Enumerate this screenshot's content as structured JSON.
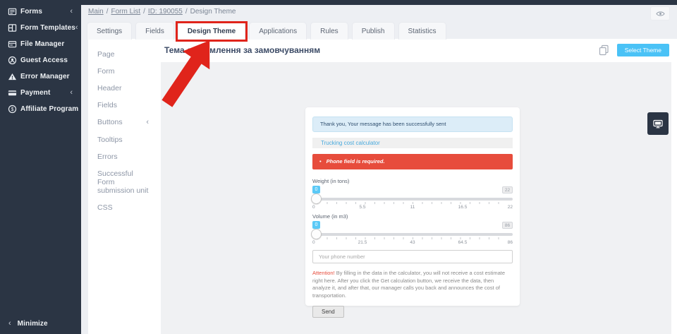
{
  "colors": {
    "sidebar_bg": "#2b3544",
    "accent_blue": "#4ac2f6",
    "link_blue": "#49aadd",
    "error_red": "#e74c3c",
    "annotation_red": "#e0241b",
    "info_alert_bg": "#dcedf8",
    "page_bg": "#edeff3",
    "preview_bg": "#f0f1f3"
  },
  "sidebar": {
    "items": [
      {
        "label": "Forms",
        "icon": "forms-icon",
        "has_submenu": true
      },
      {
        "label": "Form Templates",
        "icon": "form-templates-icon",
        "has_submenu": true
      },
      {
        "label": "File Manager",
        "icon": "file-manager-icon",
        "has_submenu": false
      },
      {
        "label": "Guest Access",
        "icon": "guest-access-icon",
        "has_submenu": false
      },
      {
        "label": "Error Manager",
        "icon": "error-manager-icon",
        "has_submenu": false
      },
      {
        "label": "Payment",
        "icon": "payment-icon",
        "has_submenu": true
      },
      {
        "label": "Affiliate Program",
        "icon": "affiliate-program-icon",
        "has_submenu": false
      }
    ],
    "chevron": "‹",
    "minimize_label": "Minimize"
  },
  "breadcrumb": {
    "separator": "/",
    "links": [
      "Main",
      "Form List",
      "ID: 190055"
    ],
    "current": "Design Theme"
  },
  "tabs": [
    {
      "label": "Settings"
    },
    {
      "label": "Fields"
    },
    {
      "label": "Design Theme",
      "active": true,
      "annotated": true
    },
    {
      "label": "Applications"
    },
    {
      "label": "Rules"
    },
    {
      "label": "Publish"
    },
    {
      "label": "Statistics"
    }
  ],
  "design_menu": {
    "items": [
      {
        "label": "Page"
      },
      {
        "label": "Form"
      },
      {
        "label": "Header"
      },
      {
        "label": "Fields"
      },
      {
        "label": "Buttons",
        "has_submenu": true
      },
      {
        "label": "Tooltips"
      },
      {
        "label": "Errors"
      },
      {
        "label": "Successful Form submission unit"
      },
      {
        "label": "CSS"
      }
    ],
    "chevron": "‹"
  },
  "theme_header": {
    "title": "Тема оформлення за замовчуванням",
    "select_theme_button": "Select Theme"
  },
  "preview_form": {
    "success_alert": "Thank you, Your message has been successfully sent",
    "form_title": "Trucking cost calculator",
    "error_bullet": "•",
    "error_alert": "Phone field is required.",
    "sliders": [
      {
        "label": "Weight (in tons)",
        "current_value": "0",
        "max_value": "22",
        "ticks": [
          "0",
          "5.5",
          "11",
          "16.5",
          "22"
        ]
      },
      {
        "label": "Volume (in m3)",
        "current_value": "0",
        "max_value": "86",
        "ticks": [
          "0",
          "21.5",
          "43",
          "64.5",
          "86"
        ]
      }
    ],
    "phone_input": {
      "placeholder": "Your phone number"
    },
    "attention_note": {
      "prefix": "Attention!",
      "text": "By filling in the data in the calculator, you will not receive a cost estimate right here. After you click the Get calculation button, we receive the data, then analyze it, and after that, our manager calls you back and announces the cost of transportation."
    },
    "send_button": "Send"
  }
}
